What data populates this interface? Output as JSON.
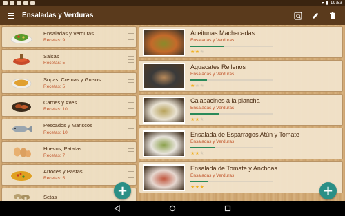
{
  "status_bar": {
    "time": "19:53"
  },
  "app_bar": {
    "title": "Ensaladas y Verduras"
  },
  "categories": [
    {
      "name": "Ensaladas y Verduras",
      "count": "Recetas: 9",
      "icon": "salad-icon"
    },
    {
      "name": "Salsas",
      "count": "Recetas: 5",
      "icon": "sauce-icon"
    },
    {
      "name": "Sopas, Cremas y Guisos",
      "count": "Recetas: 5",
      "icon": "soup-icon"
    },
    {
      "name": "Carnes y Aves",
      "count": "Recetas: 10",
      "icon": "meat-icon"
    },
    {
      "name": "Pescados y Mariscos",
      "count": "Recetas: 10",
      "icon": "fish-icon"
    },
    {
      "name": "Huevos, Patatas",
      "count": "Recetas: 7",
      "icon": "eggs-icon"
    },
    {
      "name": "Arroces y Pastas",
      "count": "Recetas: 5",
      "icon": "rice-icon"
    },
    {
      "name": "Setas",
      "count": "",
      "icon": "mushroom-icon"
    }
  ],
  "recipes": [
    {
      "title": "Aceitunas Machacadas",
      "category": "Ensaladas y Verduras",
      "progress": 0.4,
      "rating": 2,
      "colors": [
        "#c46a2a",
        "#8a8a2a"
      ]
    },
    {
      "title": "Aguacates Rellenos",
      "category": "Ensaladas y Verduras",
      "progress": 0.2,
      "rating": 1,
      "colors": [
        "#3a3a3a",
        "#b98a5a"
      ]
    },
    {
      "title": "Calabacines a la plancha",
      "category": "Ensaladas y Verduras",
      "progress": 0.35,
      "rating": 2,
      "colors": [
        "#e9e2d2",
        "#b7a25a"
      ]
    },
    {
      "title": "Ensalada de Espárragos Atún y Tomate",
      "category": "Ensaladas y Verduras",
      "progress": 0.3,
      "rating": 2,
      "colors": [
        "#e8e4dc",
        "#8aa04a"
      ]
    },
    {
      "title": "Ensalada de Tomate y Anchoas",
      "category": "Ensaladas y Verduras",
      "progress": 0.22,
      "rating": 3,
      "colors": [
        "#e6d7cf",
        "#c0533a"
      ]
    }
  ],
  "fab": {
    "label": "+"
  },
  "colors": {
    "app_bar": "#5a3a1c",
    "accent": "#2a8f86",
    "subtitle": "#c0532a"
  }
}
